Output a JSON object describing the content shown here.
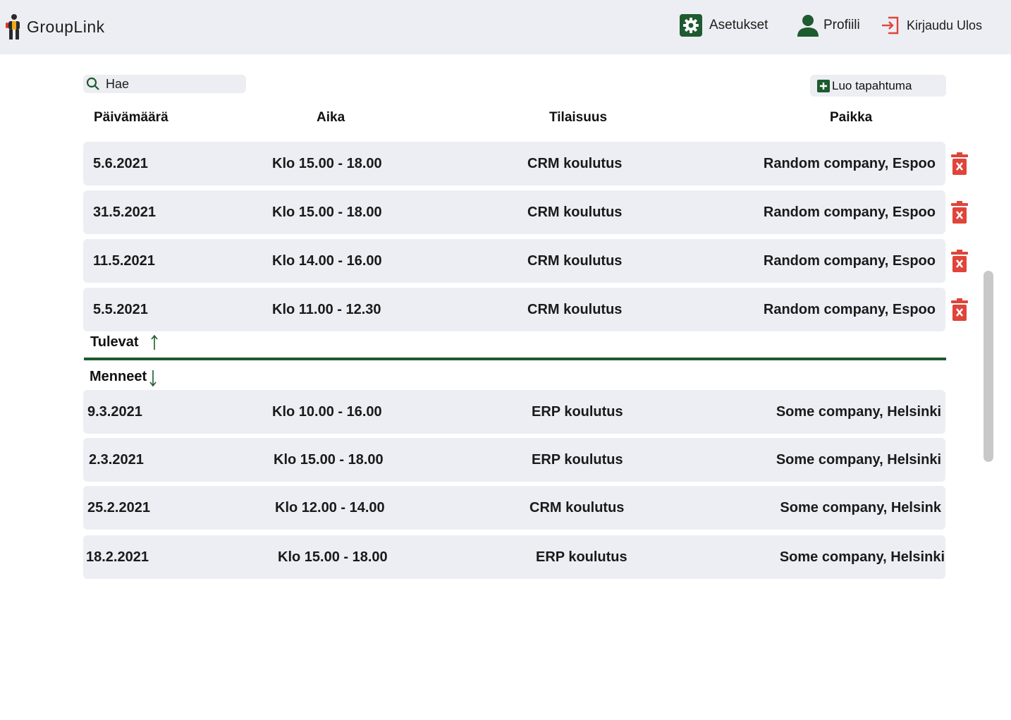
{
  "app": {
    "name": "GroupLink"
  },
  "nav": {
    "settings": "Asetukset",
    "profile": "Profiili",
    "logout": "Kirjaudu Ulos"
  },
  "search": {
    "label": "Hae"
  },
  "create_button": "Luo tapahtuma",
  "columns": {
    "date": "Päivämäärä",
    "time": "Aika",
    "event": "Tilaisuus",
    "place": "Paikka"
  },
  "upcoming": {
    "label": "Tulevat",
    "rows": [
      {
        "date": "5.6.2021",
        "time": "Klo 15.00 - 18.00",
        "event": "CRM koulutus",
        "place": "Random company, Espoo"
      },
      {
        "date": "31.5.2021",
        "time": "Klo 15.00 - 18.00",
        "event": "CRM koulutus",
        "place": "Random company, Espoo"
      },
      {
        "date": "11.5.2021",
        "time": "Klo 14.00 - 16.00",
        "event": "CRM koulutus",
        "place": "Random company, Espoo"
      },
      {
        "date": "5.5.2021",
        "time": "Klo 11.00 - 12.30",
        "event": "CRM koulutus",
        "place": "Random company, Espoo"
      }
    ]
  },
  "past": {
    "label": "Menneet",
    "rows": [
      {
        "date": "9.3.2021",
        "time": "Klo 10.00 - 16.00",
        "event": "ERP koulutus",
        "place": "Some company, Helsinki"
      },
      {
        "date": "2.3.2021",
        "time": "Klo 15.00 - 18.00",
        "event": "ERP koulutus",
        "place": "Some company, Helsinki"
      },
      {
        "date": "25.2.2021",
        "time": "Klo 12.00 - 14.00",
        "event": "CRM koulutus",
        "place": "Some company, Helsink"
      },
      {
        "date": "18.2.2021",
        "time": "Klo 15.00 - 18.00",
        "event": "ERP koulutus",
        "place": "Some company, Helsinki"
      }
    ]
  },
  "colors": {
    "accent": "#1e5b2e",
    "danger": "#e0443a",
    "surface": "#eceef3"
  },
  "icons": {
    "logo": "grouplink-logo-icon",
    "settings": "gear-icon",
    "profile": "user-icon",
    "logout": "logout-icon",
    "search": "search-icon",
    "create": "plus-icon",
    "delete": "trash-icon",
    "up": "arrow-up-icon",
    "down": "arrow-down-icon"
  }
}
